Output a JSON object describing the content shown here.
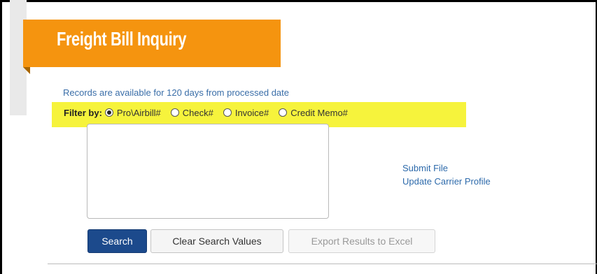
{
  "header": {
    "title": "Freight Bill Inquiry"
  },
  "info": {
    "availability_text": "Records are available for 120 days from processed date"
  },
  "filter": {
    "label": "Filter by:",
    "options": [
      {
        "label": "Pro\\Airbill#",
        "checked": true
      },
      {
        "label": "Check#",
        "checked": false
      },
      {
        "label": "Invoice#",
        "checked": false
      },
      {
        "label": "Credit Memo#",
        "checked": false
      }
    ],
    "highlight_color": "#f6f33c"
  },
  "search_input": {
    "value": "",
    "placeholder": ""
  },
  "links": {
    "submit_file": "Submit File",
    "update_carrier_profile": "Update Carrier Profile"
  },
  "buttons": {
    "search": "Search",
    "clear": "Clear Search Values",
    "export": "Export Results to Excel"
  },
  "colors": {
    "banner": "#f5940f",
    "link": "#2d6aab",
    "primary_button": "#1c4a8c"
  }
}
